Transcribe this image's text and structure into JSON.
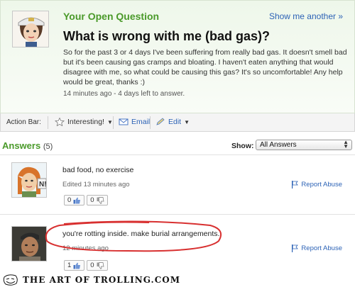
{
  "question": {
    "header": "Your Open Question",
    "show_another": "Show me another »",
    "title": "What is wrong with me (bad gas)?",
    "body": "So for the past 3 or 4 days I've been suffering from really bad gas. It doesn't smell bad but it's been causing gas cramps and bloating. I haven't eaten anything that would disagree with me, so what could be causing this gas? It's so uncomfortable! Any help would be great, thanks :)",
    "meta": "14 minutes ago - 4 days left to answer."
  },
  "action_bar": {
    "label": "Action Bar:",
    "interesting": "Interesting!",
    "email": "Email",
    "edit": "Edit"
  },
  "answers": {
    "heading": "Answers",
    "count": "(5)",
    "show_label": "Show:",
    "show_value": "All Answers",
    "items": [
      {
        "text": "bad food, no exercise",
        "meta": "Edited 13 minutes ago",
        "report": "Report Abuse",
        "thumbs_up": "0",
        "thumbs_down": "0"
      },
      {
        "text": "you're rotting inside. make burial arrangements.",
        "meta": "12 minutes ago",
        "report": "Report Abuse",
        "thumbs_up": "1",
        "thumbs_down": "0"
      }
    ]
  },
  "footer": {
    "text": "THE ART OF TROLLING.COM"
  },
  "colors": {
    "green_heading": "#4a9a2a",
    "link_blue": "#2d63b6",
    "circle_red": "#d83030"
  }
}
